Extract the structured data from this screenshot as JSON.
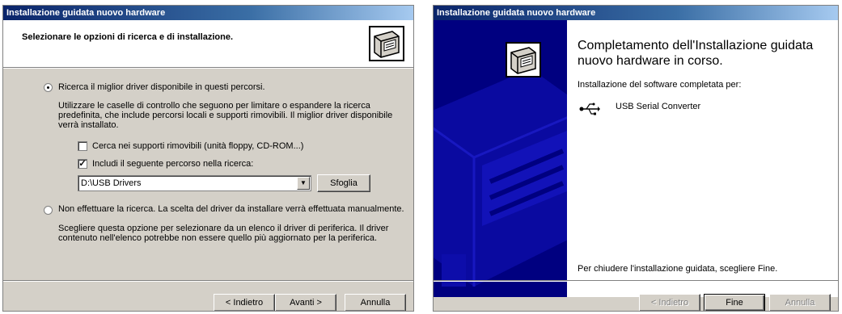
{
  "left_dialog": {
    "title": "Installazione guidata nuovo hardware",
    "header_title": "Selezionare le opzioni di ricerca e di installazione.",
    "icon": "hardware-wizard-icon",
    "option_search": {
      "label": "Ricerca il miglior driver disponibile in questi percorsi.",
      "selected": true,
      "description": "Utilizzare le caselle di controllo che seguono per limitare o espandere la ricerca predefinita, che include percorsi locali e supporti rimovibili. Il miglior driver disponibile verrà installato."
    },
    "checkbox_removable": {
      "label": "Cerca nei supporti rimovibili (unità floppy, CD-ROM...)",
      "checked": false
    },
    "checkbox_path": {
      "label": "Includi il seguente percorso nella ricerca:",
      "checked": true
    },
    "path_combo": {
      "value": "D:\\USB Drivers"
    },
    "browse_button": "Sfoglia",
    "option_manual": {
      "label": "Non effettuare la ricerca. La scelta del driver da installare verrà effettuata manualmente.",
      "selected": false,
      "description": "Scegliere questa opzione per selezionare da un elenco il driver di periferica. Il driver contenuto nell'elenco potrebbe non essere quello più aggiornato per la periferica."
    },
    "buttons": {
      "back": "< Indietro",
      "next": "Avanti >",
      "cancel": "Annulla"
    }
  },
  "right_dialog": {
    "title": "Installazione guidata nuovo hardware",
    "heading": "Completamento dell'Installazione guidata nuovo hardware in corso.",
    "completed_label": "Installazione del software completata per:",
    "device_icon": "usb-icon",
    "device_name": "USB Serial Converter",
    "footer_text": "Per chiudere l'installazione guidata, scegliere Fine.",
    "buttons": {
      "back": "< Indietro",
      "finish": "Fine",
      "cancel": "Annulla"
    }
  }
}
